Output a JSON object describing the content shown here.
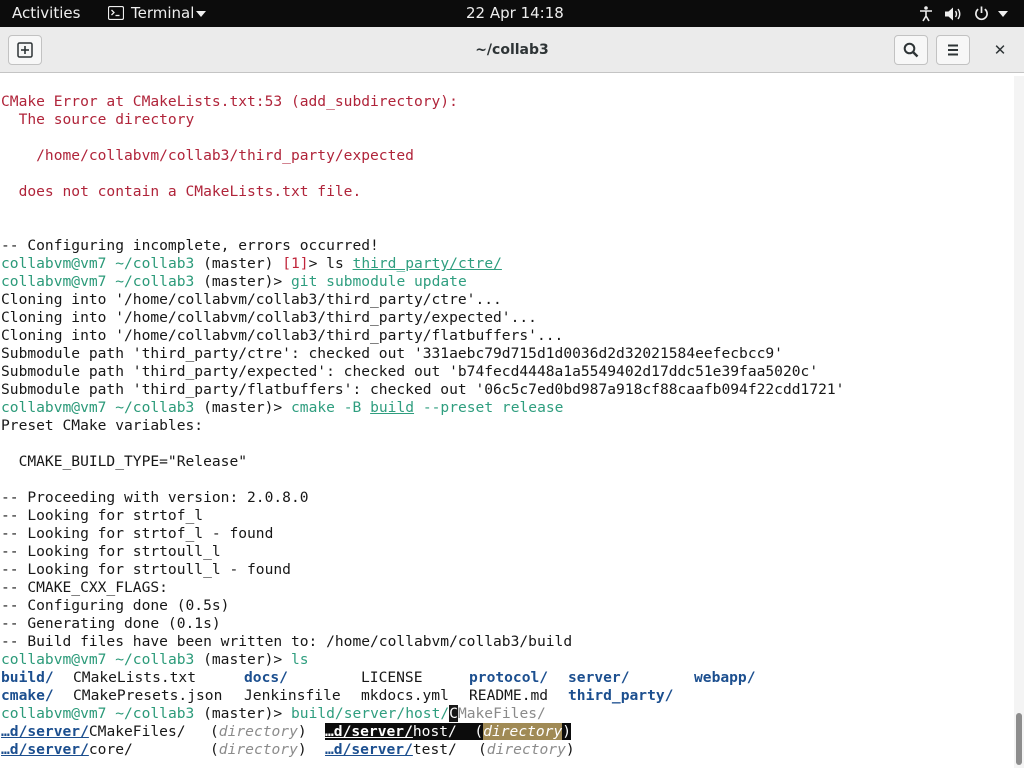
{
  "topbar": {
    "activities": "Activities",
    "app_name": "Terminal",
    "clock": "22 Apr  14:18"
  },
  "window": {
    "title": "~/collab3",
    "close_glyph": "✕"
  },
  "icons": [
    "terminal-icon",
    "caret-down-icon",
    "accessibility-icon",
    "volume-icon",
    "power-icon",
    "new-tab-icon",
    "search-icon",
    "menu-icon",
    "close-icon"
  ],
  "terminal": {
    "prompt_user": "collabvm@vm7",
    "prompt_dir": "~/collab3",
    "prompt_branch": "(master)",
    "prompt_sep": ">",
    "status_code": "[1]",
    "lines": [
      "CMake Error at CMakeLists.txt:53 (add_subdirectory):",
      "  The source directory",
      "    /home/collabvm/collab3/third_party/expected",
      "  does not contain a CMakeLists.txt file.",
      "-- Configuring incomplete, errors occurred!",
      "Cloning into '/home/collabvm/collab3/third_party/ctre'...",
      "Cloning into '/home/collabvm/collab3/third_party/expected'...",
      "Cloning into '/home/collabvm/collab3/third_party/flatbuffers'...",
      "Submodule path 'third_party/ctre': checked out '331aebc79d715d1d0036d2d32021584eefecbcc9'",
      "Submodule path 'third_party/expected': checked out 'b74fecd4448a1a5549402d17ddc51e39faa5020c'",
      "Submodule path 'third_party/flatbuffers': checked out '06c5c7ed0bd987a918cf88caafb094f22cdd1721'",
      "Preset CMake variables:",
      "  CMAKE_BUILD_TYPE=\"Release\"",
      "-- Proceeding with version: 2.0.8.0",
      "-- Looking for strtof_l",
      "-- Looking for strtof_l - found",
      "-- Looking for strtoull_l",
      "-- Looking for strtoull_l - found",
      "-- CMAKE_CXX_FLAGS:",
      "-- Configuring done (0.5s)",
      "-- Generating done (0.1s)",
      "-- Build files have been written to: /home/collabvm/collab3/build"
    ],
    "cmd_ls_ctre": {
      "cmd": "ls",
      "arg": "third_party/ctre/"
    },
    "cmd_git": {
      "cmd": "git",
      "args": "submodule update"
    },
    "cmd_cmake": {
      "cmd": "cmake",
      "flag1": "-B",
      "arg": "build",
      "flag2": "--preset release"
    },
    "cmd_ls": {
      "cmd": "ls"
    },
    "ls_output": {
      "row1": [
        {
          "name": "build/",
          "dir": true
        },
        {
          "name": "CMakeLists.txt",
          "dir": false
        },
        {
          "name": "docs/",
          "dir": true
        },
        {
          "name": "LICENSE",
          "dir": false
        },
        {
          "name": "protocol/",
          "dir": true
        },
        {
          "name": "server/",
          "dir": true
        },
        {
          "name": "webapp/",
          "dir": true
        }
      ],
      "row2": [
        {
          "name": "cmake/",
          "dir": true
        },
        {
          "name": "CMakePresets.json",
          "dir": false
        },
        {
          "name": "Jenkinsfile",
          "dir": false
        },
        {
          "name": "mkdocs.yml",
          "dir": false
        },
        {
          "name": "README.md",
          "dir": false
        },
        {
          "name": "third_party/",
          "dir": true
        }
      ]
    },
    "current_input": {
      "before_cursor": "build/server/host/",
      "cursor_char": "C",
      "after_cursor": "MakeFiles/"
    },
    "completions": {
      "prefix": "…d/server/",
      "desc": "directory",
      "items": [
        "CMakeFiles/",
        "host/",
        "core/",
        "test/"
      ]
    }
  }
}
